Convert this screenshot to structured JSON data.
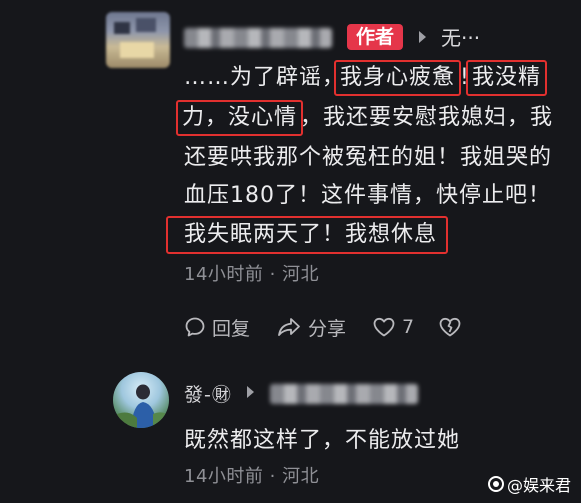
{
  "comment1": {
    "author_badge": "作者",
    "reply_to": "无···",
    "line1_prefix": "……为了辟谣，",
    "hl_tired": "我身心疲惫",
    "excl1": "!",
    "hl_no_energy": "我没精",
    "hl_no_mood": "力，没心情",
    "line2_rest": "，我还要安慰我媳妇，我",
    "line3": "还要哄我那个被冤枉的姐！我姐哭的",
    "line4": "血压180了！这件事情，快停止吧！",
    "hl_insomnia": "我失眠两天了！我想休息",
    "meta": "14小时前 · 河北",
    "actions": {
      "reply": "回复",
      "share": "分享",
      "like_count": "7"
    }
  },
  "comment2": {
    "username": "發-㊖",
    "text": "既然都这样了，不能放过她",
    "meta": "14小时前 · 河北"
  },
  "watermark": "@娱来君",
  "colors": {
    "background": "#16171b",
    "highlight_border": "#e2302f",
    "author_badge": "#e5364a",
    "meta_text": "#8f9096"
  },
  "icons": [
    "comment-bubble-icon",
    "share-arrow-icon",
    "heart-icon",
    "broken-heart-icon",
    "chevron-right-icon"
  ]
}
